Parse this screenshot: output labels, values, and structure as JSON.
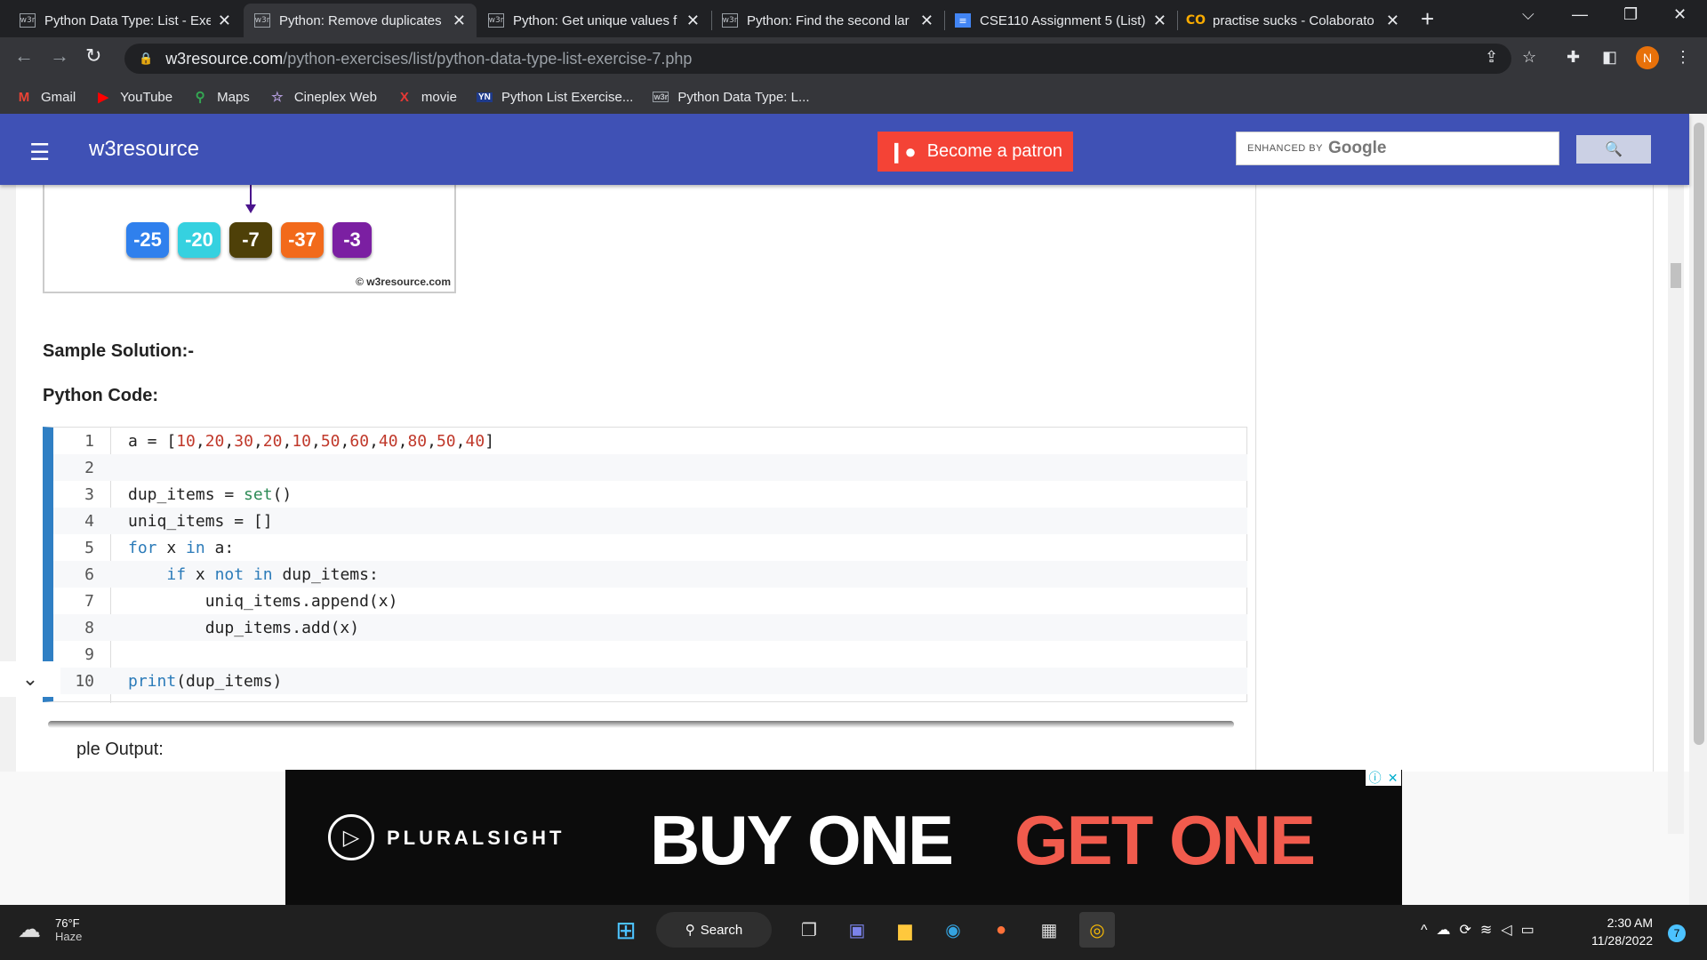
{
  "browser": {
    "tabs": [
      {
        "title": "Python Data Type: List - Exe",
        "favicon": "w3r"
      },
      {
        "title": "Python: Remove duplicates",
        "favicon": "w3r"
      },
      {
        "title": "Python: Get unique values f",
        "favicon": "w3r"
      },
      {
        "title": "Python: Find the second lar",
        "favicon": "w3r"
      },
      {
        "title": "CSE110 Assignment 5 (List)",
        "favicon": "≡"
      },
      {
        "title": "practise sucks - Colaborato",
        "favicon": "CO"
      }
    ],
    "url_domain": "w3resource.com",
    "url_path": "/python-exercises/list/python-data-type-list-exercise-7.php",
    "profile_initial": "N",
    "bookmarks": [
      {
        "label": "Gmail",
        "icon": "M"
      },
      {
        "label": "YouTube",
        "icon": "▶"
      },
      {
        "label": "Maps",
        "icon": "⚲"
      },
      {
        "label": "Cineplex Web",
        "icon": "☆"
      },
      {
        "label": "movie",
        "icon": "X"
      },
      {
        "label": "Python List Exercise...",
        "icon": "YN"
      },
      {
        "label": "Python Data Type: L...",
        "icon": "w3r"
      }
    ]
  },
  "site": {
    "name": "w3resource",
    "patron_label": "Become a patron",
    "search_enhanced": "ENHANCED BY",
    "search_brand": "Google",
    "search_button_icon": "🔍"
  },
  "figure": {
    "chips": [
      "-25",
      "-20",
      "-7",
      "-37",
      "-3"
    ],
    "chip_colors": [
      "#2f80ed",
      "#35d1e0",
      "#4e4008",
      "#f26a1b",
      "#7b1fa2"
    ],
    "copyright": "© w3resource.com"
  },
  "content": {
    "sample_solution": "Sample Solution:-",
    "python_code": "Python Code:",
    "sample_output": "ple Output:",
    "code_lines": [
      {
        "num": "1",
        "text": "a = [10,20,30,20,10,50,60,40,80,50,40]"
      },
      {
        "num": "2",
        "text": ""
      },
      {
        "num": "3",
        "text": "dup_items = set()"
      },
      {
        "num": "4",
        "text": "uniq_items = []"
      },
      {
        "num": "5",
        "text": "for x in a:"
      },
      {
        "num": "6",
        "text": "    if x not in dup_items:"
      },
      {
        "num": "7",
        "text": "        uniq_items.append(x)"
      },
      {
        "num": "8",
        "text": "        dup_items.add(x)"
      },
      {
        "num": "9",
        "text": ""
      },
      {
        "num": "10",
        "text": "print(dup_items)"
      }
    ]
  },
  "ad": {
    "brand": "PLURALSIGHT",
    "headline_a": "BUY ONE",
    "headline_b": "GET ONE"
  },
  "taskbar": {
    "temp": "76°F",
    "weather": "Haze",
    "search_label": "Search",
    "time": "2:30 AM",
    "date": "11/28/2022",
    "notifications": "7"
  }
}
